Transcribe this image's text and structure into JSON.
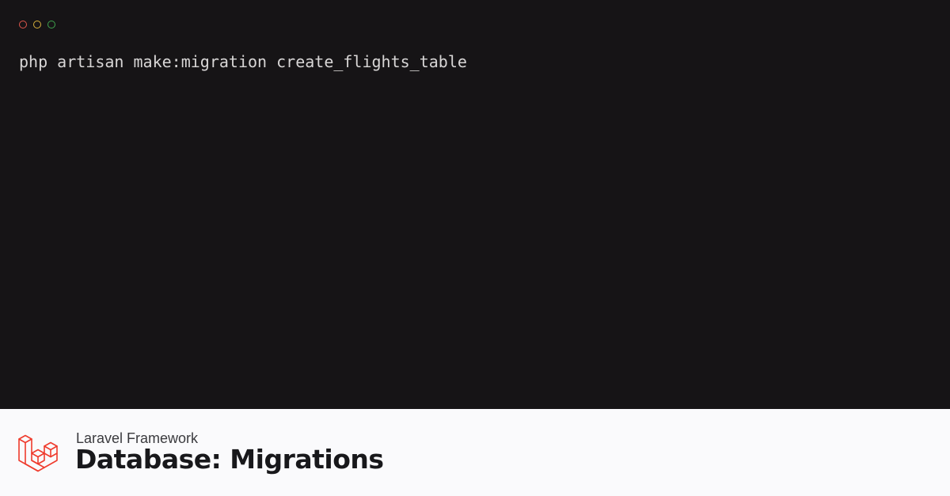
{
  "terminal": {
    "command": "php artisan make:migration create_flights_table",
    "background": "#161416",
    "text_color": "#d8d6d6",
    "window_dots": [
      {
        "name": "close",
        "color": "#e0574c"
      },
      {
        "name": "minimize",
        "color": "#d8b13b"
      },
      {
        "name": "maximize",
        "color": "#3fa34d"
      }
    ]
  },
  "footer": {
    "logo": {
      "icon": "laravel-logo-icon",
      "color": "#ef3b2d"
    },
    "subtitle": "Laravel Framework",
    "title": "Database: Migrations",
    "subtitle_color": "#3a3a3e",
    "title_color": "#18181b"
  }
}
